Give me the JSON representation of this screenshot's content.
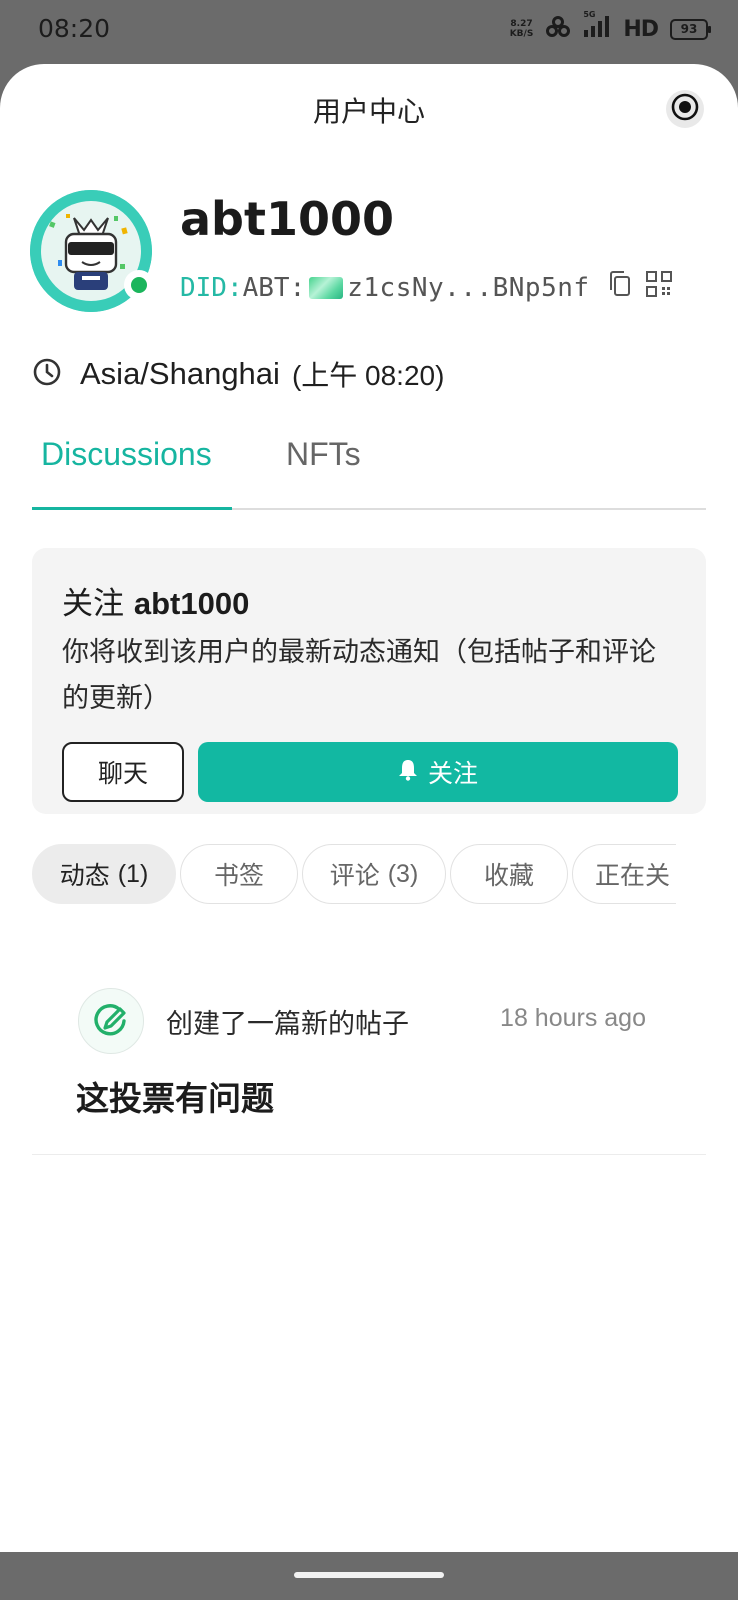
{
  "status_bar": {
    "time": "08:20",
    "net_speed_value": "8.27",
    "net_speed_unit": "KB/S",
    "signal_label": "5G",
    "hd_label": "HD",
    "battery": "93"
  },
  "header": {
    "title": "用户中心"
  },
  "profile": {
    "username": "abt1000",
    "did_prefix": "DID:",
    "did_chain": "ABT:",
    "did_value": "z1csNy...BNp5nf",
    "online": true,
    "timezone": "Asia/Shanghai",
    "local_time": "(上午 08:20)"
  },
  "tabs": [
    {
      "label": "Discussions",
      "active": true
    },
    {
      "label": "NFTs",
      "active": false
    }
  ],
  "follow_card": {
    "title_prefix": "关注",
    "title_user": "abt1000",
    "description": "你将收到该用户的最新动态通知（包括帖子和评论的更新）",
    "chat_label": "聊天",
    "follow_label": "关注"
  },
  "filters": [
    {
      "label": "动态",
      "count": "(1)",
      "active": true
    },
    {
      "label": "书签",
      "count": "",
      "active": false
    },
    {
      "label": "评论",
      "count": "(3)",
      "active": false
    },
    {
      "label": "收藏",
      "count": "",
      "active": false
    },
    {
      "label": "正在关",
      "count": "",
      "active": false
    }
  ],
  "activity": {
    "action": "创建了一篇新的帖子",
    "time": "18 hours ago",
    "post_title": "这投票有问题"
  },
  "colors": {
    "accent": "#16b5a0",
    "button": "#12b8a2",
    "online": "#1bb55c"
  }
}
